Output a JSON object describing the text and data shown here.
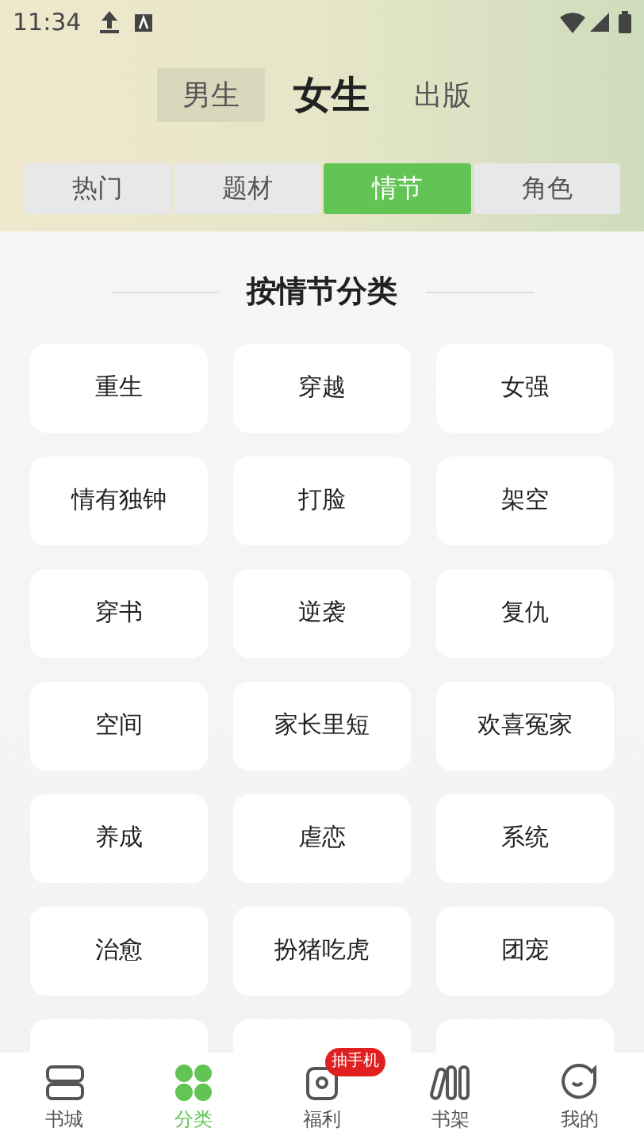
{
  "status_bar": {
    "time": "11:34"
  },
  "gender_tabs": [
    {
      "label": "男生",
      "selected": false
    },
    {
      "label": "女生",
      "selected": true
    },
    {
      "label": "出版",
      "selected": false
    }
  ],
  "category_tabs": [
    {
      "label": "热门",
      "selected": false
    },
    {
      "label": "题材",
      "selected": false
    },
    {
      "label": "情节",
      "selected": true
    },
    {
      "label": "角色",
      "selected": false
    }
  ],
  "section_title": "按情节分类",
  "tags": [
    "重生",
    "穿越",
    "女强",
    "情有独钟",
    "打脸",
    "架空",
    "穿书",
    "逆袭",
    "复仇",
    "空间",
    "家长里短",
    "欢喜冤家",
    "养成",
    "虐恋",
    "系统",
    "治愈",
    "扮猪吃虎",
    "团宠"
  ],
  "bottom_nav": [
    {
      "label": "书城",
      "kind": "books",
      "selected": false
    },
    {
      "label": "分类",
      "kind": "grid",
      "selected": true
    },
    {
      "label": "福利",
      "kind": "gift",
      "selected": false,
      "badge": "抽手机"
    },
    {
      "label": "书架",
      "kind": "shelf",
      "selected": false
    },
    {
      "label": "我的",
      "kind": "face",
      "selected": false
    }
  ]
}
